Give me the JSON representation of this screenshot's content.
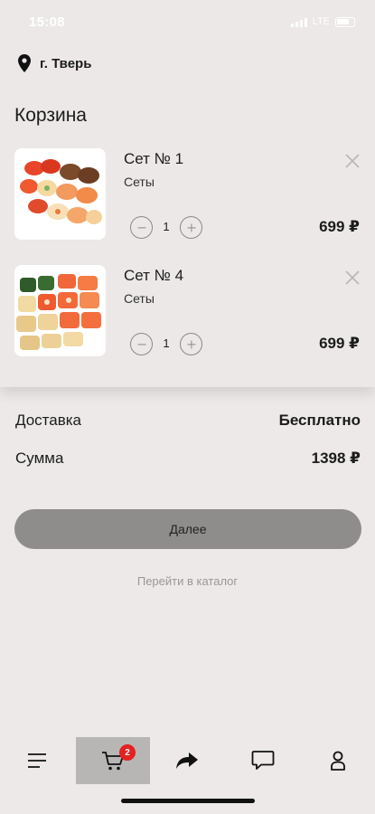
{
  "status": {
    "time": "15:08",
    "network": "LTE"
  },
  "location": {
    "city": "г. Тверь",
    "icon": "map-pin-icon"
  },
  "cart": {
    "title": "Корзина",
    "items": [
      {
        "name": "Сет № 1",
        "category": "Сеты",
        "quantity": "1",
        "price": "699 ₽"
      },
      {
        "name": "Сет № 4",
        "category": "Сеты",
        "quantity": "1",
        "price": "699 ₽"
      }
    ]
  },
  "summary": {
    "delivery_label": "Доставка",
    "delivery_value": "Бесплатно",
    "total_label": "Сумма",
    "total_value": "1398 ₽"
  },
  "actions": {
    "next_label": "Далее",
    "catalog_link": "Перейти в каталог"
  },
  "bottom_nav": {
    "items": [
      {
        "icon": "menu-icon"
      },
      {
        "icon": "cart-icon",
        "badge": "2",
        "active": true
      },
      {
        "icon": "share-icon"
      },
      {
        "icon": "chat-icon"
      },
      {
        "icon": "profile-icon"
      }
    ]
  },
  "colors": {
    "background": "#ece9e8",
    "button": "#8e8d8c",
    "active_tab": "#b7b6b5",
    "badge": "#e42020"
  }
}
